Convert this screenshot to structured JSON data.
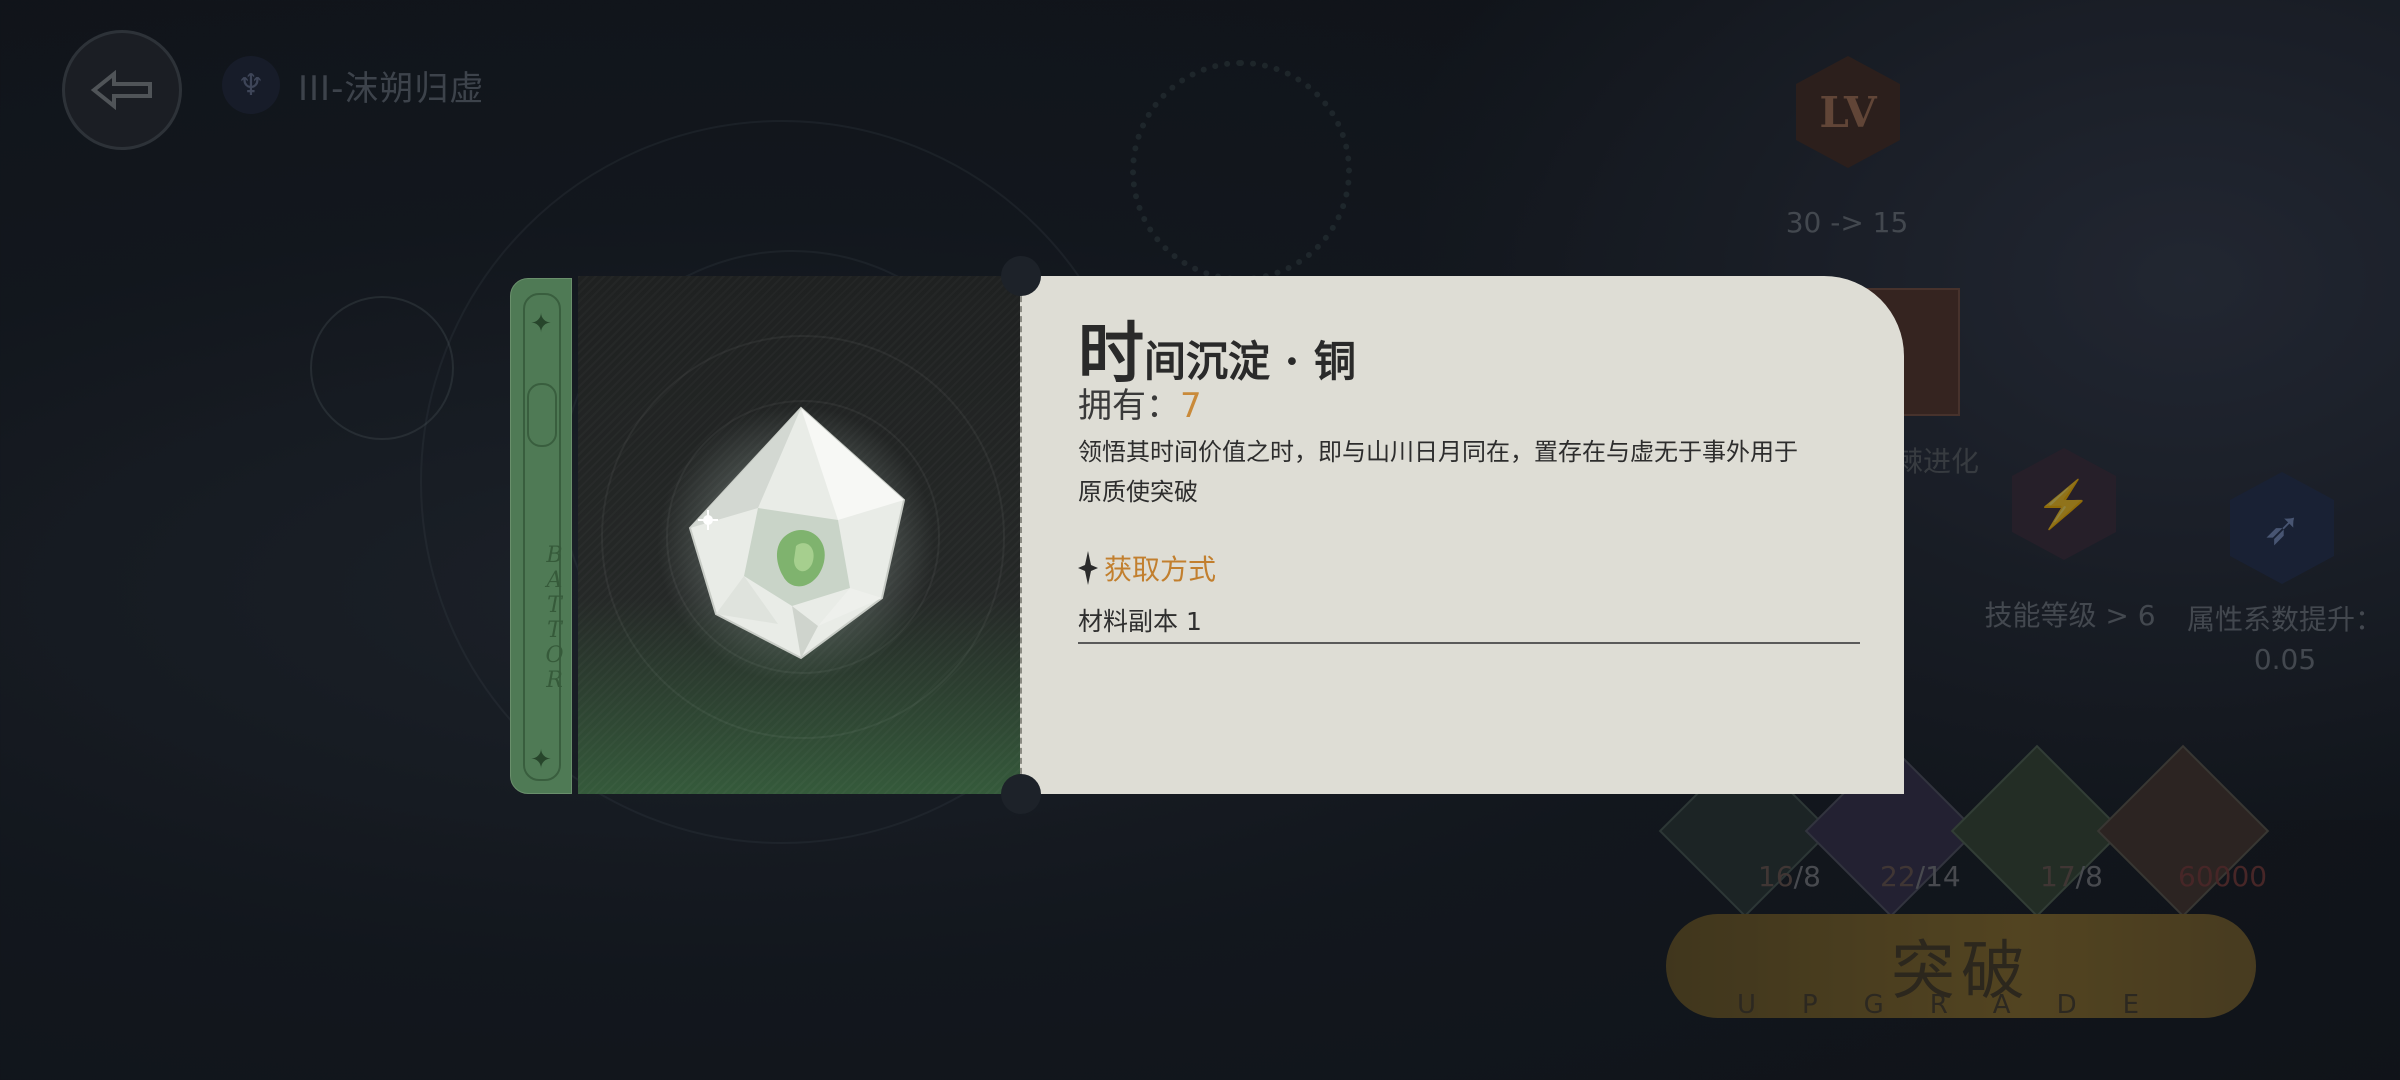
{
  "header": {
    "chapter_title": "III-沫朔归虚"
  },
  "upgrade_tree": {
    "level_icon_text": "LV",
    "level_label": "30 -> 15",
    "evolution_label": "旧日龙棘进化",
    "skill_label": "技能等级 > 6",
    "attribute_label": "属性系数提升：0.05"
  },
  "materials": [
    {
      "have": "16",
      "need": "/8"
    },
    {
      "have": "22",
      "need": "/14"
    },
    {
      "have": "17",
      "need": "/8"
    },
    {
      "have": "60000",
      "need": ""
    }
  ],
  "breakthrough": {
    "label": "突破",
    "sub": "UPGRADE"
  },
  "item_card": {
    "title_first_char": "时",
    "title_rest": "间沉淀 · 铜",
    "owned_label": "拥有：",
    "owned_count": "7",
    "description": "领悟其时间价值之时，即与山川日月同在，置存在与虚无于事外用于原质使突破",
    "source_title": "获取方式",
    "sources": [
      "材料副本 1"
    ],
    "tab_letters": "BATTOR",
    "tab_color": "#4f7a55",
    "accent_color": "#c98a3a"
  },
  "icons": {
    "back": "back-arrow-icon",
    "chapter": "chapter-emblem-icon",
    "gem": "crystal-gem-icon",
    "source_marker": "four-point-star-icon"
  }
}
